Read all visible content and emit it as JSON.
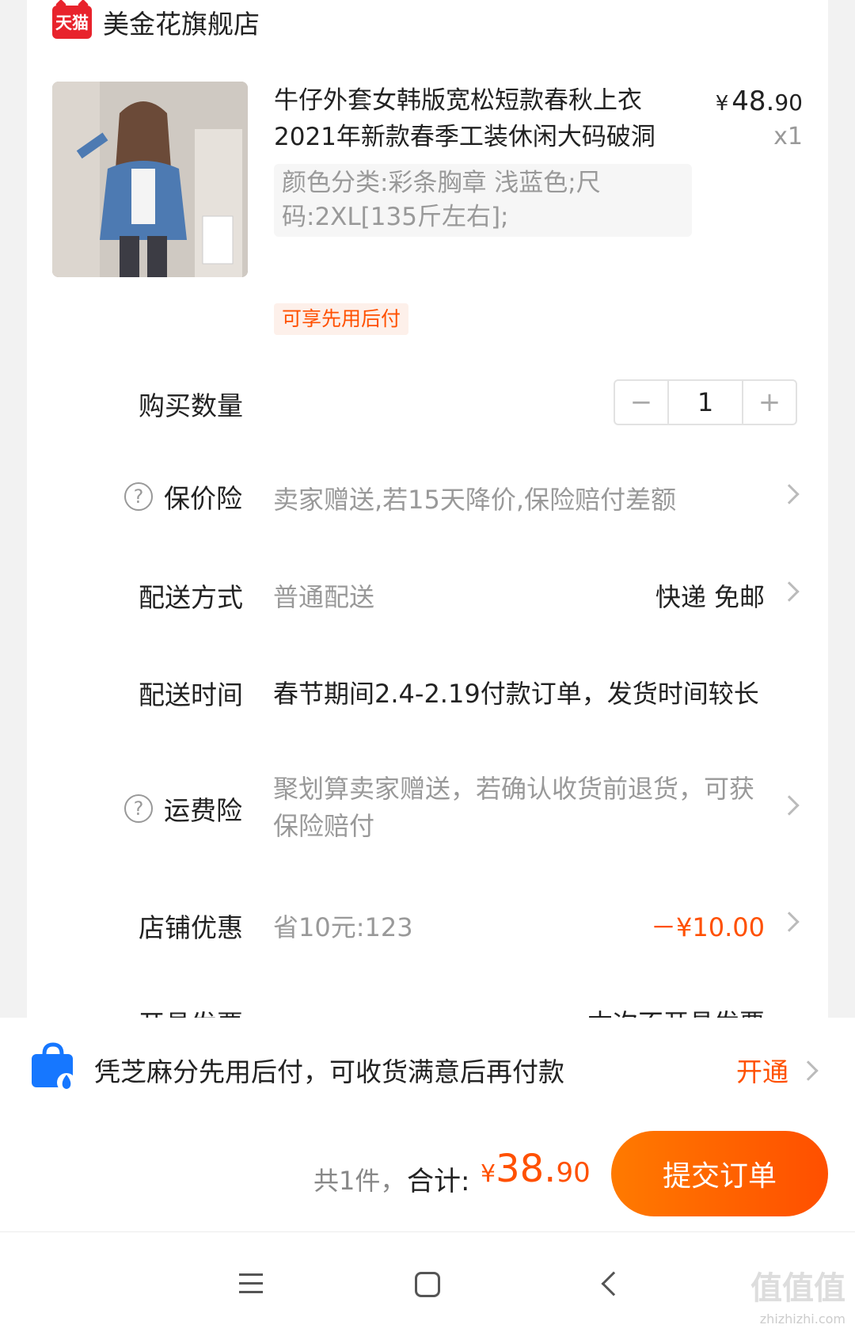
{
  "shop": {
    "badge": "天猫",
    "name": "美金花旗舰店"
  },
  "product": {
    "title": "牛仔外套女韩版宽松短款春秋上衣2021年新款春季工装休闲大码破洞",
    "price_yen": "¥",
    "price_int": "48.",
    "price_dec": "90",
    "qty": "x1",
    "sku": "颜色分类:彩条胸章 浅蓝色;尺码:2XL[135斤左右];",
    "tag": "可享先用后付"
  },
  "rows": {
    "quantity": {
      "label": "购买数量",
      "value": "1",
      "minus": "−",
      "plus": "+"
    },
    "price_protect": {
      "label": "保价险",
      "value": "卖家赠送,若15天降价,保险赔付差额"
    },
    "delivery": {
      "label": "配送方式",
      "value": "普通配送",
      "right": "快递 免邮"
    },
    "delivery_time": {
      "label": "配送时间",
      "value": "春节期间2.4-2.19付款订单，发货时间较长"
    },
    "shipping_ins": {
      "label": "运费险",
      "value": "聚划算卖家赠送，若确认收货前退货，可获保险赔付"
    },
    "shop_discount": {
      "label": "店铺优惠",
      "value": "省10元:123",
      "right": "－¥10.00"
    },
    "invoice": {
      "label": "开具发票",
      "right": "本次不开具发票"
    }
  },
  "bnpl": {
    "text": "凭芝麻分先用后付，可收货满意后再付款",
    "action": "开通"
  },
  "summary": {
    "count": "共1件，",
    "total_label": "合计:",
    "total_yen": "¥",
    "total_int": "38.",
    "total_dec": "90",
    "submit": "提交订单"
  },
  "watermark": {
    "main": "值值值",
    "sub": "zhizhizhi.com"
  }
}
